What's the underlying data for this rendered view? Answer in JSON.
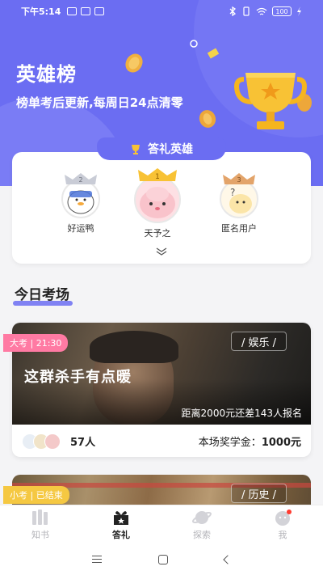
{
  "status_bar": {
    "time": "下午5:14",
    "battery": "100"
  },
  "header": {
    "title": "英雄榜",
    "subtitle": "榜单考后更新,每周日24点清零"
  },
  "heroes": {
    "tab_label": "答礼英雄",
    "users": [
      {
        "rank": "2",
        "name": "好运鸭"
      },
      {
        "rank": "1",
        "name": "天予之"
      },
      {
        "rank": "3",
        "name": "匿名用户"
      }
    ]
  },
  "section": {
    "title": "今日考场"
  },
  "exam_cards": [
    {
      "tag": "大考 | 21:30",
      "category": "/ 娱乐 /",
      "title": "这群杀手有点暖",
      "note": "距离2000元还差143人报名",
      "participants": "57人",
      "prize_label": "本场奖学金：",
      "prize_value": "1000元"
    },
    {
      "tag": "小考 | 已结束",
      "category": "/ 历史 /"
    }
  ],
  "bottom_nav": [
    {
      "label": "知书",
      "icon": "books-icon",
      "active": false
    },
    {
      "label": "答礼",
      "icon": "gift-icon",
      "active": true
    },
    {
      "label": "探索",
      "icon": "planet-icon",
      "active": false
    },
    {
      "label": "我",
      "icon": "profile-icon",
      "active": false
    }
  ],
  "colors": {
    "primary": "#6b6df2",
    "tag_pink": "#ff7aa3",
    "tag_yellow": "#f5c842",
    "gold": "#f5b51e"
  }
}
